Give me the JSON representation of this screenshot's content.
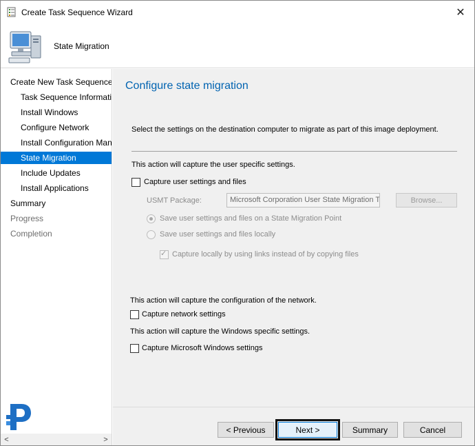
{
  "window": {
    "title": "Create Task Sequence Wizard",
    "close_glyph": "✕"
  },
  "header": {
    "title": "State Migration",
    "icon": "computer-icon"
  },
  "nav": {
    "items": [
      {
        "label": "Create New Task Sequence",
        "level": 0,
        "state": "normal"
      },
      {
        "label": "Task Sequence Information",
        "level": 1,
        "state": "normal"
      },
      {
        "label": "Install Windows",
        "level": 1,
        "state": "normal"
      },
      {
        "label": "Configure Network",
        "level": 1,
        "state": "normal"
      },
      {
        "label": "Install Configuration Manager",
        "level": 1,
        "state": "normal"
      },
      {
        "label": "State Migration",
        "level": 1,
        "state": "selected"
      },
      {
        "label": "Include Updates",
        "level": 1,
        "state": "normal"
      },
      {
        "label": "Install Applications",
        "level": 1,
        "state": "normal"
      },
      {
        "label": "Summary",
        "level": 0,
        "state": "normal"
      },
      {
        "label": "Progress",
        "level": 0,
        "state": "disabled"
      },
      {
        "label": "Completion",
        "level": 0,
        "state": "disabled"
      }
    ],
    "scroll_left": "<",
    "scroll_right": ">"
  },
  "content": {
    "title": "Configure state migration",
    "description": "Select the settings on the destination computer to migrate as part of this image deployment.",
    "user_section": {
      "intro": "This action will capture the user specific settings.",
      "capture_user_label": "Capture user settings and files",
      "capture_user_checked": false,
      "usmt_label": "USMT Package:",
      "usmt_value": "Microsoft Corporation User State Migration Tool",
      "browse_label": "Browse...",
      "radio_smp_label": "Save user settings and files on a State Migration Point",
      "radio_local_label": "Save user settings and files locally",
      "links_label": "Capture locally by using links instead of by copying files",
      "links_checked": true
    },
    "network_section": {
      "intro": "This action will capture the configuration of the network.",
      "capture_label": "Capture network settings",
      "checked": false
    },
    "windows_section": {
      "intro": "This action will capture the Windows specific settings.",
      "capture_label": "Capture Microsoft Windows settings",
      "checked": false
    }
  },
  "footer": {
    "previous_label": "< Previous",
    "next_label": "Next >",
    "summary_label": "Summary",
    "cancel_label": "Cancel"
  },
  "colors": {
    "accent": "#0078d7",
    "title_blue": "#0063b1",
    "panel": "#f0f0f0"
  }
}
